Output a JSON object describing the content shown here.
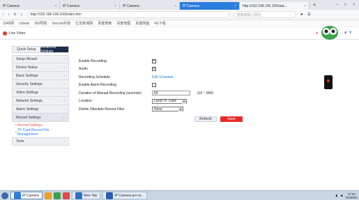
{
  "browser": {
    "tabs": [
      {
        "title": "IP Camera",
        "active": false
      },
      {
        "title": "IP Camera",
        "active": false
      },
      {
        "title": "IP Camera",
        "active": false
      },
      {
        "title": "IP Camera",
        "active": true
      },
      {
        "title": "http://192.168.199.165/stat...",
        "active": false
      }
    ],
    "new_tab": "+",
    "url": "http://192.168.199.165/index.htm",
    "search_placeholder": "搜索或输入网址",
    "bookmarks": [
      "2345网",
      "cnbeta",
      "360导航",
      "Seccon科技",
      "亿龙新城网",
      "百度搜索",
      "百度地图",
      "百度网盘",
      "4G下载"
    ]
  },
  "header": {
    "live_video": "Live Video"
  },
  "sidebar": {
    "tabs": [
      "Quick Setup",
      "Advanced Settings"
    ],
    "items": [
      {
        "label": "Setup Wizard"
      },
      {
        "label": "Device Status"
      },
      {
        "label": "Basic Settings"
      },
      {
        "label": "Security Settings"
      },
      {
        "label": "Video Settings"
      },
      {
        "label": "Network Settings"
      },
      {
        "label": "Alarm Settings"
      },
      {
        "label": "Record Settings"
      }
    ],
    "subitems": [
      "Record Settings",
      "TF Card Record File Management"
    ],
    "last_item": "Tools"
  },
  "form": {
    "enable_recording": {
      "label": "Enable Recording",
      "checked": true
    },
    "audio": {
      "label": "Audio",
      "checked": true
    },
    "schedule": {
      "label": "Recording Schedule",
      "link": "Edit Schedule"
    },
    "alarm_recording": {
      "label": "Enable Alarm Recording",
      "checked": false
    },
    "duration": {
      "label": "Duration of Manual Recording (seconds)",
      "value": "60",
      "range": "(10 ~ 900)"
    },
    "location": {
      "label": "Location",
      "value": "Local TF Card"
    },
    "delete_old": {
      "label": "Delete Obsolete Record Files",
      "value": "None"
    }
  },
  "buttons": {
    "refresh": "Refresh",
    "save": "Save"
  },
  "taskbar": {
    "items": [
      "IP Camera",
      "New Tab",
      "IP Camera pro st..."
    ],
    "time": "17:04",
    "date": "2016/6/1"
  },
  "colors": {
    "accent": "#2b7de0",
    "sidebar_active_tab": "#1b2c4b",
    "save": "#e42b2b"
  }
}
